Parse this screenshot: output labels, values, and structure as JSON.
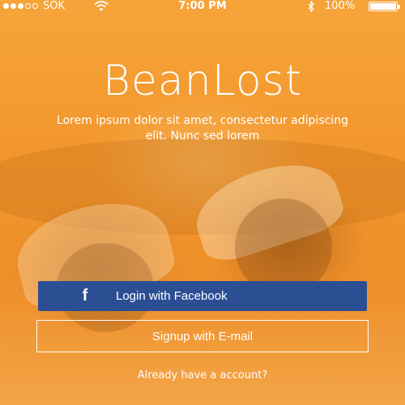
{
  "status_bar": {
    "signal_dots_filled": 3,
    "signal_dots_total": 5,
    "carrier": "SOK",
    "time": "7:00 PM",
    "battery_percent": "100%",
    "icons": [
      "wifi-icon",
      "bluetooth-icon",
      "battery-icon"
    ]
  },
  "app": {
    "title": "BeanLost",
    "tagline": "Lorem ipsum dolor sit amet, consectetur adipiscing elit. Nunc sed lorem"
  },
  "actions": {
    "facebook_label": "Login with Facebook",
    "facebook_icon": "facebook-icon",
    "email_label": "Signup with E-mail",
    "login_link": "Already have a account?"
  },
  "colors": {
    "background_orange": "#f2962c",
    "facebook_blue": "#2c4f94",
    "text": "#ffffff"
  }
}
